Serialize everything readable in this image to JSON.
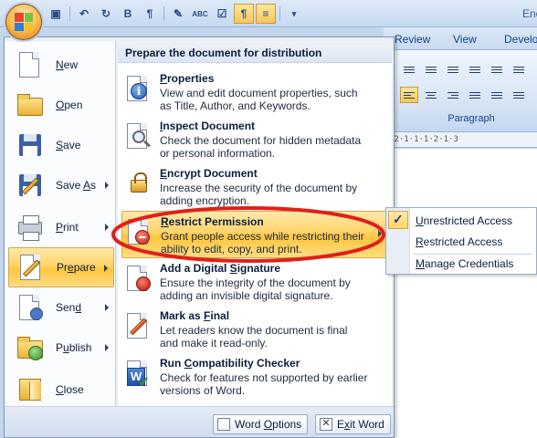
{
  "window": {
    "title_fragment": "Enc"
  },
  "quick_access": {
    "items": [
      {
        "name": "save-icon",
        "glyph": "💾"
      },
      {
        "name": "undo-icon",
        "glyph": "↶"
      },
      {
        "name": "redo-icon",
        "glyph": "↻"
      },
      {
        "name": "bold-icon",
        "glyph": "B"
      },
      {
        "name": "paragraph-icon",
        "glyph": "¶"
      },
      {
        "name": "format-painter-icon",
        "glyph": "✎"
      },
      {
        "name": "spelling-icon",
        "glyph": "ABC"
      },
      {
        "name": "track-changes-icon",
        "glyph": "☑"
      },
      {
        "name": "show-formatting-icon",
        "glyph": "¶"
      },
      {
        "name": "justify-icon",
        "glyph": "≡"
      },
      {
        "name": "customize-icon",
        "glyph": "▾"
      }
    ]
  },
  "ribbon": {
    "tabs": [
      "Review",
      "View",
      "Develo"
    ],
    "group_label": "Paragraph",
    "ruler_text": "·2·1·1·1·2·1·3"
  },
  "menu": {
    "left_items": [
      {
        "label": "New",
        "underline": "N",
        "rest": "ew",
        "icon": "new-document-icon",
        "has_arrow": false
      },
      {
        "label": "Open",
        "underline": "O",
        "rest": "pen",
        "icon": "open-folder-icon",
        "has_arrow": false
      },
      {
        "label": "Save",
        "underline": "S",
        "rest": "ave",
        "icon": "save-icon",
        "has_arrow": false
      },
      {
        "label": "Save As",
        "underline": "A",
        "prefix": "Save ",
        "rest": "s",
        "icon": "save-as-icon",
        "has_arrow": true
      },
      {
        "label": "Print",
        "underline": "P",
        "rest": "rint",
        "icon": "printer-icon",
        "has_arrow": true
      },
      {
        "label": "Prepare",
        "underline": "E",
        "prefix": "Pr",
        "rest": "pare",
        "icon": "prepare-icon",
        "has_arrow": true
      },
      {
        "label": "Send",
        "underline": "D",
        "prefix": "Sen",
        "rest": "",
        "icon": "send-icon",
        "has_arrow": true
      },
      {
        "label": "Publish",
        "underline": "U",
        "prefix": "P",
        "rest": "blish",
        "icon": "publish-icon",
        "has_arrow": true
      },
      {
        "label": "Close",
        "underline": "C",
        "rest": "lose",
        "icon": "close-folder-icon",
        "has_arrow": false
      }
    ],
    "selected_left": "Prepare",
    "submenu_header": "Prepare the document for distribution",
    "submenu_items": [
      {
        "title": "Properties",
        "u": "P",
        "rest": "roperties",
        "desc": "View and edit document properties, such as Title, Author, and Keywords.",
        "icon": "properties-icon"
      },
      {
        "title": "Inspect Document",
        "u": "I",
        "rest": "nspect Document",
        "desc": "Check the document for hidden metadata or personal information.",
        "icon": "inspect-document-icon"
      },
      {
        "title": "Encrypt Document",
        "u": "E",
        "rest": "ncrypt Document",
        "desc": "Increase the security of the document by adding encryption.",
        "icon": "encrypt-lock-icon"
      },
      {
        "title": "Restrict Permission",
        "u": "R",
        "rest": "estrict Permission",
        "desc": "Grant people access while restricting their ability to edit, copy, and print.",
        "icon": "restrict-permission-icon"
      },
      {
        "title": "Add a Digital Signature",
        "u": "S",
        "prefix": "Add a Digital ",
        "rest": "ignature",
        "desc": "Ensure the integrity of the document by adding an invisible digital signature.",
        "icon": "digital-signature-icon"
      },
      {
        "title": "Mark as Final",
        "u": "F",
        "prefix": "Mark as ",
        "rest": "inal",
        "desc": "Let readers know the document is final and make it read-only.",
        "icon": "mark-final-icon"
      },
      {
        "title": "Run Compatibility Checker",
        "u": "C",
        "prefix": "Run ",
        "rest": "ompatibility Checker",
        "desc": "Check for features not supported by earlier versions of Word.",
        "icon": "compatibility-checker-icon"
      }
    ],
    "selected_submenu": "Restrict Permission",
    "footer": {
      "word_options": {
        "u": "O",
        "prefix": "Word ",
        "rest": "ptions"
      },
      "exit_word": {
        "u": "x",
        "prefix": "E",
        "rest": "it Word"
      }
    }
  },
  "flyout": {
    "items": [
      {
        "label": "Unrestricted Access",
        "u": "U",
        "rest": "nrestricted Access",
        "checked": true
      },
      {
        "label": "Restricted Access",
        "u": "R",
        "rest": "estricted Access",
        "checked": false
      },
      {
        "label": "Manage Credentials",
        "u": "M",
        "rest": "anage Credentials",
        "checked": false
      }
    ]
  },
  "colors": {
    "highlight_ring": "#e0201a",
    "selected_gradient_top": "#ffe9a8",
    "selected_gradient_mid": "#ffc53d",
    "menu_text": "#0b1e3f",
    "ribbon_text": "#15428b"
  }
}
